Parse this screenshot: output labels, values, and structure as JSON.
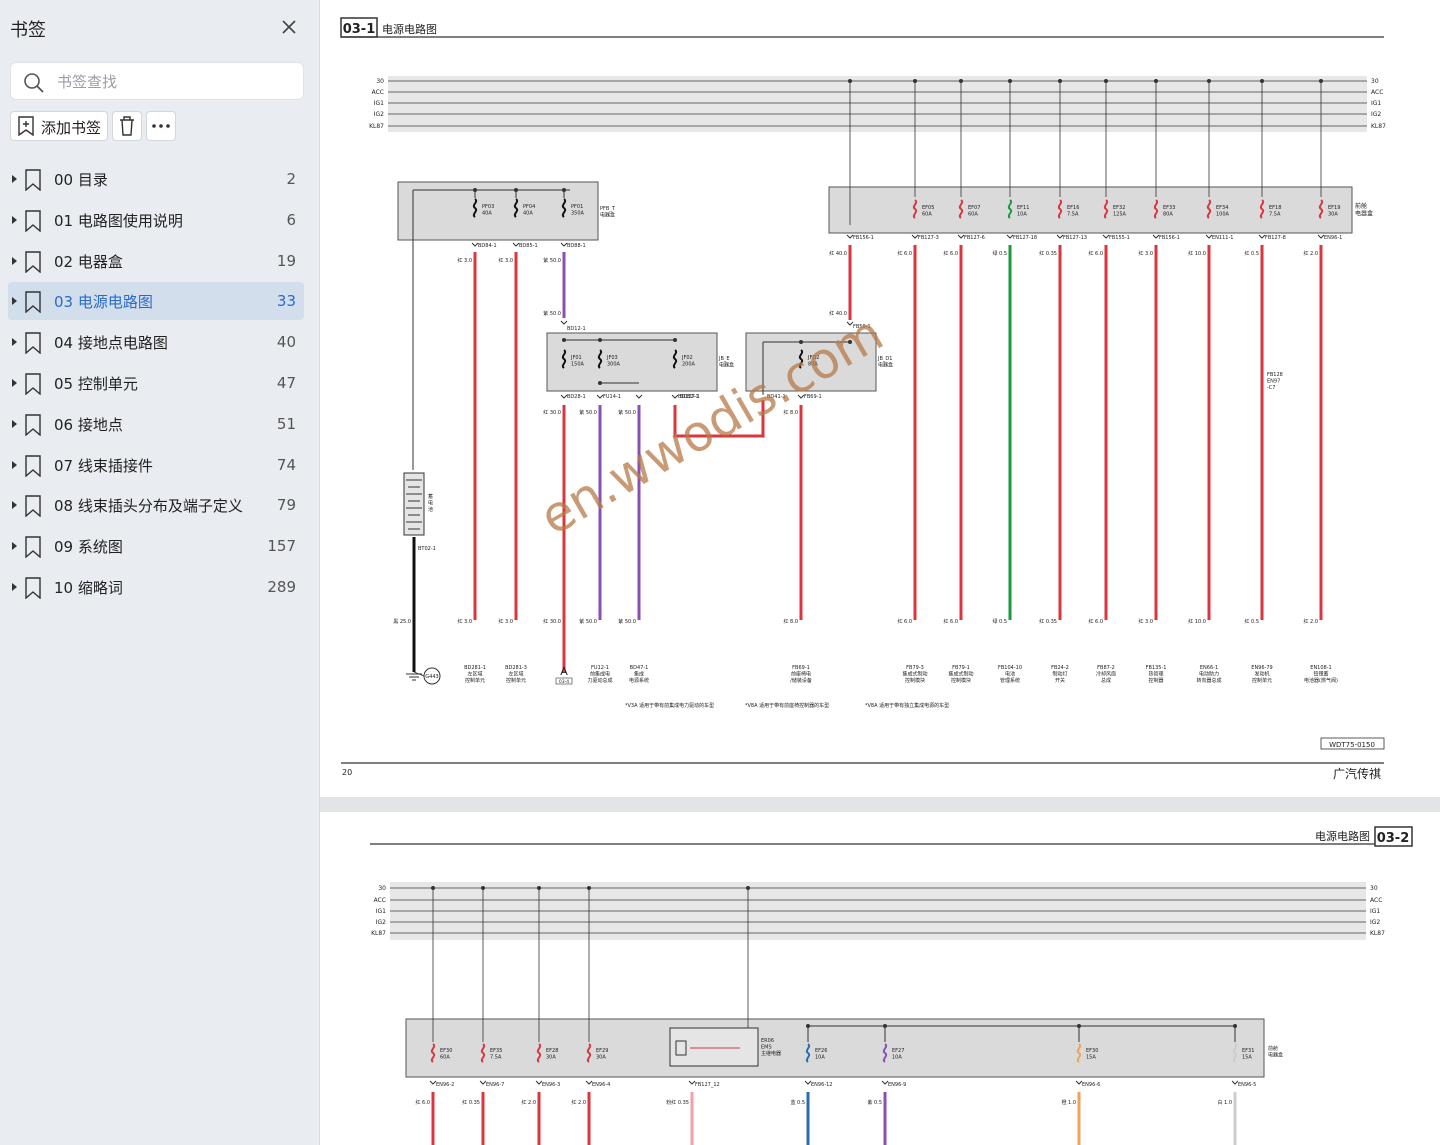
{
  "sidebar": {
    "title": "书签",
    "search_placeholder": "书签查找",
    "add_label": "添加书签",
    "items": [
      {
        "label": "00 目录",
        "page": "2"
      },
      {
        "label": "01 电路图使用说明",
        "page": "6"
      },
      {
        "label": "02 电器盒",
        "page": "19"
      },
      {
        "label": "03 电源电路图",
        "page": "33"
      },
      {
        "label": "04 接地点电路图",
        "page": "40"
      },
      {
        "label": "05 控制单元",
        "page": "47"
      },
      {
        "label": "06 接地点",
        "page": "51"
      },
      {
        "label": "07 线束插接件",
        "page": "74"
      },
      {
        "label": "08 线束插头分布及端子定义",
        "page": "79"
      },
      {
        "label": "09 系统图",
        "page": "157"
      },
      {
        "label": "10 缩略词",
        "page": "289"
      }
    ],
    "active_index": 3
  },
  "page1": {
    "section_code": "03-1",
    "section_title": "电源电路图",
    "page_number": "20",
    "doc_code": "WDT75-0150",
    "brand": "广汽传祺",
    "watermark": "en.wwodis.com",
    "bus_labels": [
      "30",
      "ACC",
      "IG1",
      "IG2",
      "KL87"
    ],
    "box_pfb": "PFB_T\n电器盒",
    "box_jbe": "JB_E\n电器盒",
    "box_jbd": "JB_D1\n电器盒",
    "box_front": "前舱\n电器盒",
    "battery_label": "蓄\n电\n池",
    "ground_label": "G443",
    "left_fuses": [
      {
        "name": "PF03",
        "rating": "40A",
        "conn": "BD84-1",
        "wire": "红 3.0",
        "dest": "BD281-1\n左区域\n控制单元"
      },
      {
        "name": "PF04",
        "rating": "40A",
        "conn": "BD85-1",
        "wire": "红 3.0",
        "dest": "BD281-3\n左区域\n控制单元"
      },
      {
        "name": "PF01",
        "rating": "350A",
        "conn": "BD88-1",
        "wire": "紫 50.0",
        "dest": ""
      }
    ],
    "jbe_fuses": [
      {
        "name": "JF01",
        "rating": "150A",
        "conn": "BD28-1",
        "wire": "红 30.0",
        "dest": "A"
      },
      {
        "name": "JF03",
        "rating": "300A",
        "conn": "FU14-1",
        "wire": "紫 50.0",
        "dest": "FU12-1\n前集成电\n力驱动总成"
      },
      {
        "name": "JF02",
        "rating": "200A",
        "conn": "BD227-1",
        "wire": "紫 50.0",
        "dest": "BD47-1\n集成\n电源系统"
      }
    ],
    "jbd_fuse": {
      "name": "JFD2",
      "rating": "80A",
      "conn": "FB69-1",
      "wire": "红 8.0",
      "dest": "FB69-1\n前座椅电\n/储装设备"
    },
    "front_fuses": [
      {
        "name": "EF05",
        "rating": "60A",
        "conn": "FB127-3",
        "wire": "红 6.0",
        "dest": "FB79-3\n集成式制动\n控制模块"
      },
      {
        "name": "EF07",
        "rating": "60A",
        "conn": "FB127-6",
        "wire": "红 6.0",
        "dest": "FB79-1\n集成式制动\n控制模块"
      },
      {
        "name": "EF11",
        "rating": "10A",
        "conn": "FB127-18",
        "wire": "绿 0.5",
        "dest": "FB104-10\n电池\n管理系统"
      },
      {
        "name": "EF16",
        "rating": "7.5A",
        "conn": "FB127-13",
        "wire": "红 0.35",
        "dest": "FB24-2\n制动灯\n开关"
      },
      {
        "name": "EF32",
        "rating": "125A",
        "conn": "FB155-1",
        "wire": "红 6.0",
        "dest": "FB87-2\n冷却风扇\n总成"
      },
      {
        "name": "EF33",
        "rating": "80A",
        "conn": "FB156-1",
        "wire": "红 3.0",
        "dest": "FB135-1\n热管理\n控制器"
      },
      {
        "name": "EF34",
        "rating": "100A",
        "conn": "EN111-1",
        "wire": "红 10.0",
        "dest": "EN66-1\n电动助力\n转向器总成"
      },
      {
        "name": "EF18",
        "rating": "7.5A",
        "conn": "FB127-8",
        "wire": "红 0.5",
        "dest": "EN96-79\n发动机\n控制单元"
      },
      {
        "name": "EF19",
        "rating": "30A",
        "conn": "EN96-1",
        "wire": "红 2.0",
        "dest": "EN108-1\n铅锂蓄\n电池器(燃气阀)"
      }
    ],
    "fb156": "FB156-1",
    "fb50": "FB50-1",
    "fb128": "FB128\nEN97\n-C7",
    "notes": [
      "*V3A 适用于带有前集成电力驱动的车型",
      "*V8A 适用于带有前座椅控制器的车型",
      "*V8A 适用于带有独立集成电源的车型"
    ]
  },
  "page2": {
    "section_code": "03-2",
    "section_title": "电源电路图",
    "box_label": "前舱\n电器盒",
    "relay_label": "ER06\nEMS\n主继电器",
    "fuses": [
      {
        "name": "EF30",
        "rating": "60A",
        "conn": "EN96-2",
        "wire": "红 6.0"
      },
      {
        "name": "EF35",
        "rating": "7.5A",
        "conn": "EN96-7",
        "wire": "红 0.35"
      },
      {
        "name": "EF28",
        "rating": "30A",
        "conn": "EN96-3",
        "wire": "红 2.0"
      },
      {
        "name": "EF29",
        "rating": "30A",
        "conn": "EN96-4",
        "wire": "红 2.0"
      },
      {
        "name": "",
        "rating": "",
        "conn": "FB127_12",
        "wire": "粉红 0.35"
      },
      {
        "name": "EF26",
        "rating": "10A",
        "conn": "EN96-12",
        "wire": "蓝 0.5"
      },
      {
        "name": "EF27",
        "rating": "10A",
        "conn": "EN96-9",
        "wire": "紫 0.5"
      },
      {
        "name": "EF30",
        "rating": "15A",
        "conn": "EN96-6",
        "wire": "橙 1.0"
      },
      {
        "name": "EF31",
        "rating": "15A",
        "conn": "EN96-5",
        "wire": "白 1.0"
      }
    ]
  },
  "colors": {
    "accent": "#2a6bc9",
    "active_bg": "#d3deec",
    "wire_red": "#d9363e",
    "wire_purple": "#8a4fb3",
    "wire_green": "#1a9a3c",
    "wire_black": "#111111",
    "wire_pink": "#f2a0aa",
    "wire_blue": "#2b6cb0",
    "wire_orange": "#f0a257",
    "wire_white": "#cccccc",
    "watermark": "#b57a48"
  }
}
